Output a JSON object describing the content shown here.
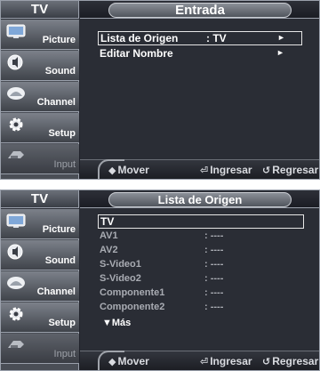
{
  "sidebar": {
    "tv_label": "TV",
    "items": [
      {
        "label": "Picture",
        "icon": "picture-icon"
      },
      {
        "label": "Sound",
        "icon": "sound-icon"
      },
      {
        "label": "Channel",
        "icon": "channel-icon"
      },
      {
        "label": "Setup",
        "icon": "setup-icon"
      },
      {
        "label": "Input",
        "icon": "input-icon"
      }
    ]
  },
  "screen1": {
    "title": "Entrada",
    "rows": [
      {
        "label": "Lista de Origen",
        "value": ": TV",
        "arrow": "►"
      },
      {
        "label": "Editar Nombre",
        "value": "",
        "arrow": "►"
      }
    ]
  },
  "screen2": {
    "title": "Lista de Origen",
    "selected": "TV",
    "items": [
      {
        "label": "AV1",
        "value": ": ----"
      },
      {
        "label": "AV2",
        "value": ": ----"
      },
      {
        "label": "S-Video1",
        "value": ": ----"
      },
      {
        "label": "S-Video2",
        "value": ": ----"
      },
      {
        "label": "Componente1",
        "value": ": ----"
      },
      {
        "label": "Componente2",
        "value": ": ----"
      }
    ],
    "more": "▼Más"
  },
  "hints": {
    "move": "Mover",
    "move_icon": "◆",
    "enter": "Ingresar",
    "enter_icon": "⏎",
    "back": "Regresar",
    "back_icon": "↺"
  }
}
